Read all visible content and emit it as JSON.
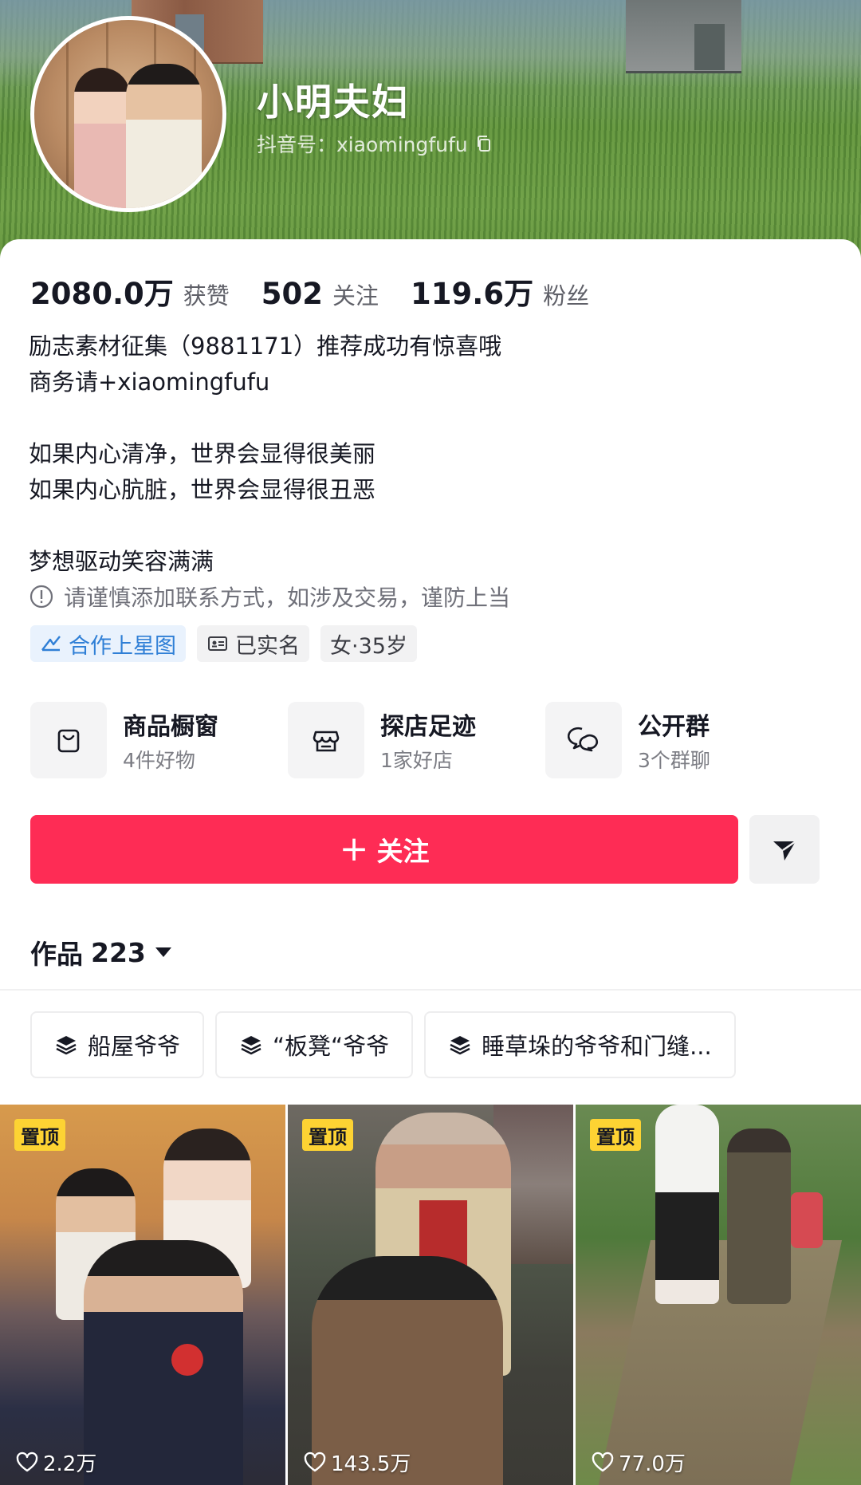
{
  "profile": {
    "name": "小明夫妇",
    "douyin_id": "抖音号：xiaomingfufu"
  },
  "stats": [
    {
      "value": "2080.0万",
      "label": "获赞"
    },
    {
      "value": "502",
      "label": "关注"
    },
    {
      "value": "119.6万",
      "label": "粉丝"
    }
  ],
  "bio": {
    "line1": "励志素材征集（9881171）推荐成功有惊喜哦",
    "line2": "商务请+xiaomingfufu",
    "line3": "如果内心清净，世界会显得很美丽",
    "line4": "如果内心肮脏，世界会显得很丑恶",
    "line5": "梦想驱动笑容满满"
  },
  "warning": "请谨慎添加联系方式，如涉及交易，谨防上当",
  "tags": {
    "star_map": "合作上星图",
    "verified": "已实名",
    "gender_age": "女·35岁"
  },
  "entries": [
    {
      "title": "商品橱窗",
      "subtitle": "4件好物",
      "icon": "shopping-bag-icon"
    },
    {
      "title": "探店足迹",
      "subtitle": "1家好店",
      "icon": "store-icon"
    },
    {
      "title": "公开群",
      "subtitle": "3个群聊",
      "icon": "chat-bubbles-icon"
    }
  ],
  "actions": {
    "follow_plus": "+",
    "follow_label": "关注"
  },
  "works": {
    "label": "作品",
    "count": "223"
  },
  "collections": [
    {
      "label": "船屋爷爷"
    },
    {
      "label": "“板凳“爷爷"
    },
    {
      "label": "睡草垛的爷爷和门缝..."
    }
  ],
  "videos": [
    {
      "badge": "置顶",
      "likes": "2.2万"
    },
    {
      "badge": "置顶",
      "likes": "143.5万"
    },
    {
      "badge": "置顶",
      "likes": "77.0万"
    }
  ],
  "colors": {
    "follow_button": "#fe2c55",
    "pin_badge": "#fdd333",
    "star_map_tag": "#2f7fd6"
  }
}
